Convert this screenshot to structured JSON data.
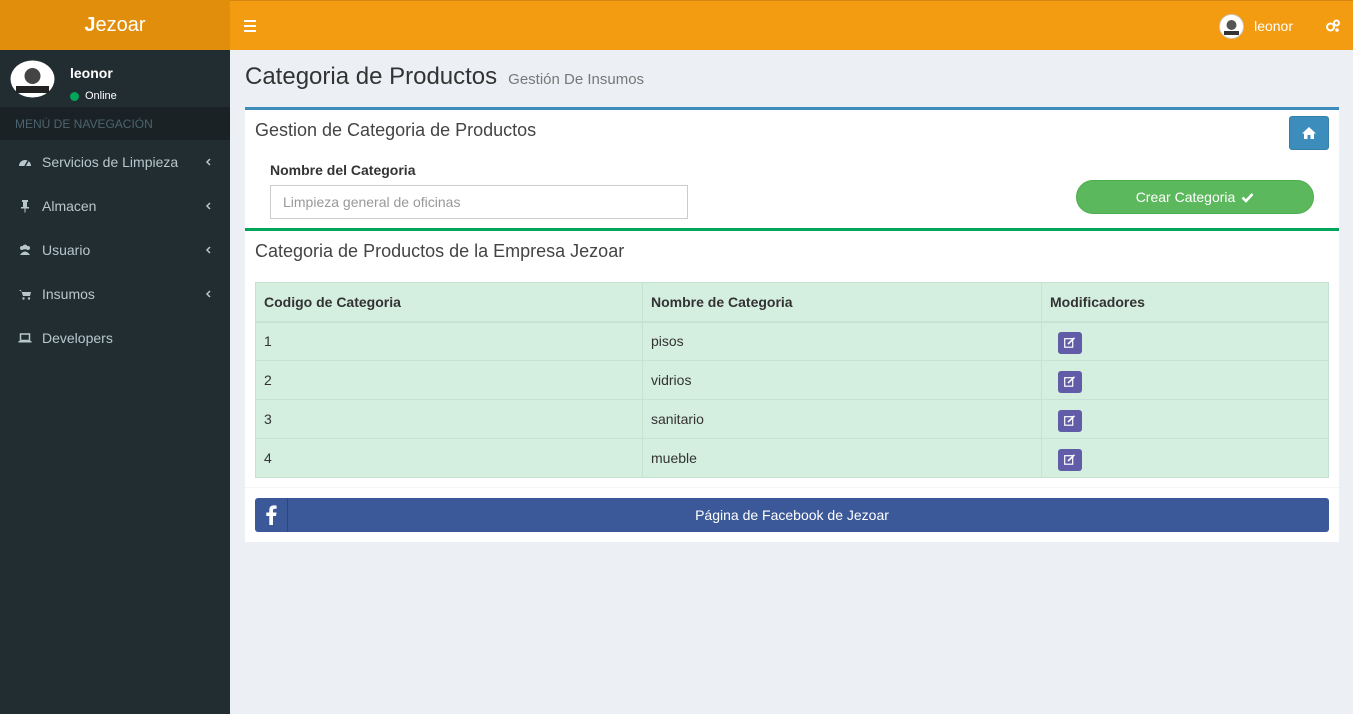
{
  "app": {
    "logo_bold": "J",
    "logo_rest": "ezoar"
  },
  "navbar": {
    "user_name": "leonor",
    "icons": [
      "menu-icon",
      "gears-icon"
    ]
  },
  "sidebar": {
    "user_name": "leonor",
    "status": "Online",
    "menu_header": "MENÚ DE NAVEGACIÓN",
    "items": [
      {
        "label": "Servicios de Limpieza",
        "icon": "dashboard-icon"
      },
      {
        "label": "Almacen",
        "icon": "pin-icon"
      },
      {
        "label": "Usuario",
        "icon": "users-icon"
      },
      {
        "label": "Insumos",
        "icon": "cart-icon"
      },
      {
        "label": "Developers",
        "icon": "laptop-icon"
      }
    ]
  },
  "page": {
    "title": "Categoria de Productos",
    "subtitle": "Gestión De Insumos"
  },
  "form_box": {
    "title": "Gestion de Categoria de Productos",
    "field_label": "Nombre del Categoria",
    "field_placeholder": "Limpieza general de oficinas",
    "field_value": "",
    "create_label": "Crear Categoria"
  },
  "table_box": {
    "title": "Categoria de Productos de la Empresa Jezoar",
    "headers": [
      "Codigo de Categoria",
      "Nombre de Categoria",
      "Modificadores"
    ],
    "rows": [
      {
        "code": "1",
        "name": "pisos"
      },
      {
        "code": "2",
        "name": "vidrios"
      },
      {
        "code": "3",
        "name": "sanitario"
      },
      {
        "code": "4",
        "name": "mueble"
      }
    ],
    "facebook_label": "Página de Facebook de Jezoar"
  },
  "colors": {
    "header": "#f39c12",
    "logo": "#e08e0b",
    "sidebar": "#222d32",
    "primary": "#3c8dbc",
    "success": "#5cb85c",
    "purple": "#605ca8",
    "facebook": "#3b5998"
  }
}
